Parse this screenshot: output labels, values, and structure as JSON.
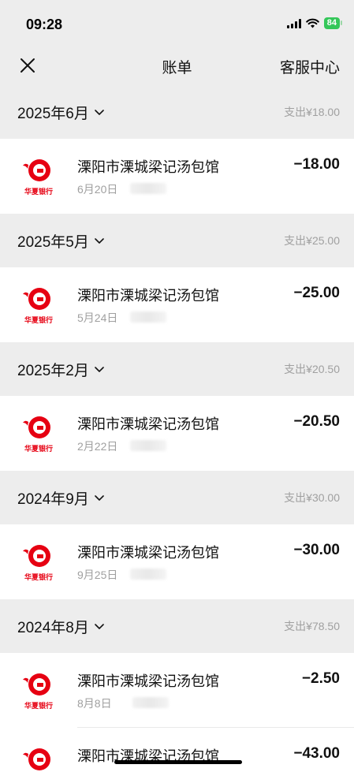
{
  "status_bar": {
    "time": "09:28",
    "battery": "84"
  },
  "nav": {
    "title": "账单",
    "service_label": "客服中心",
    "close_icon": "close-icon"
  },
  "brand": {
    "logo_text": "华夏银行",
    "logo_color": "#e60012"
  },
  "months": [
    {
      "label": "2025年6月",
      "total": "支出¥18.00",
      "transactions": [
        {
          "merchant": "溧阳市溧城梁记汤包馆",
          "date": "6月20日",
          "amount": "−18.00"
        }
      ]
    },
    {
      "label": "2025年5月",
      "total": "支出¥25.00",
      "transactions": [
        {
          "merchant": "溧阳市溧城梁记汤包馆",
          "date": "5月24日",
          "amount": "−25.00"
        }
      ]
    },
    {
      "label": "2025年2月",
      "total": "支出¥20.50",
      "transactions": [
        {
          "merchant": "溧阳市溧城梁记汤包馆",
          "date": "2月22日",
          "amount": "−20.50"
        }
      ]
    },
    {
      "label": "2024年9月",
      "total": "支出¥30.00",
      "transactions": [
        {
          "merchant": "溧阳市溧城梁记汤包馆",
          "date": "9月25日",
          "amount": "−30.00"
        }
      ]
    },
    {
      "label": "2024年8月",
      "total": "支出¥78.50",
      "transactions": [
        {
          "merchant": "溧阳市溧城梁记汤包馆",
          "date": "8月8日",
          "amount": "−2.50"
        },
        {
          "merchant": "溧阳市溧城梁记汤包馆",
          "date": "",
          "amount": "−43.00"
        }
      ]
    }
  ]
}
